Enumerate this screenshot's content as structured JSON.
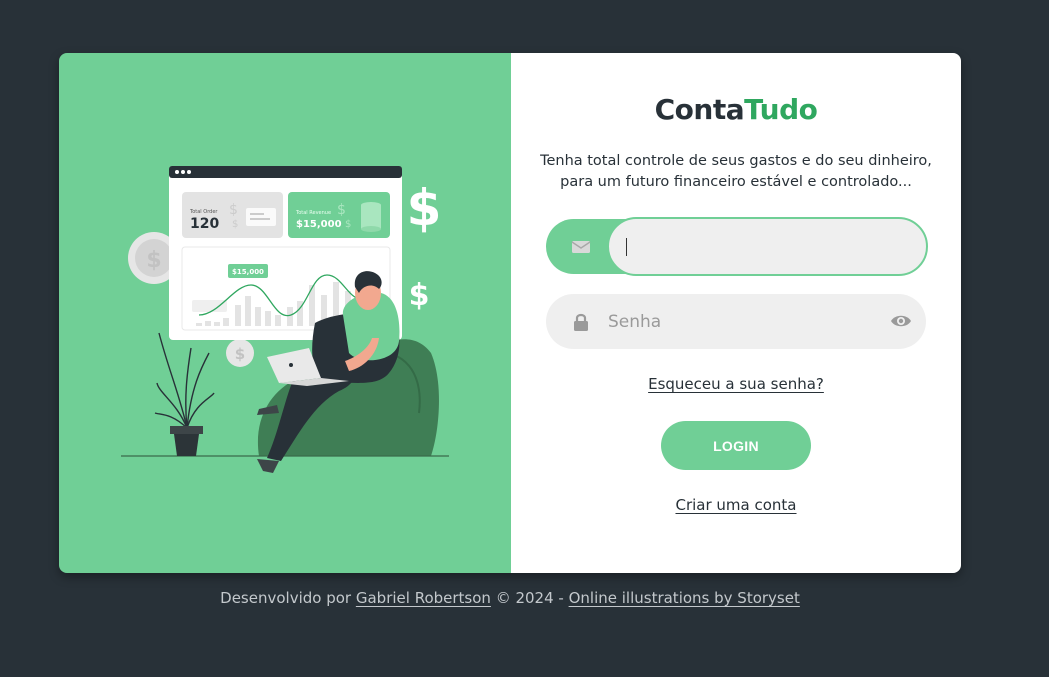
{
  "brand": {
    "part1": "Conta",
    "part2": "Tudo"
  },
  "tagline": "Tenha total controle de seus gastos e do seu dinheiro, para um futuro financeiro estável e controlado...",
  "email_field": {
    "value": "",
    "placeholder": "",
    "icon": "envelope-icon"
  },
  "password_field": {
    "value": "",
    "placeholder": "Senha",
    "icon": "lock-icon",
    "toggle_icon": "eye-icon"
  },
  "forgot_link": "Esqueceu a sua senha?",
  "login_button": "LOGIN",
  "create_link": "Criar uma conta",
  "illustration": {
    "dollar_sign": "$",
    "total_order_label": "Total Order",
    "total_order_value": "120",
    "total_revenue_label": "Total Revenue",
    "total_revenue_value": "$15,000",
    "chart_callout": "$15,000"
  },
  "footer": {
    "prefix": "Desenvolvido por ",
    "author": "Gabriel Robertson",
    "middle": " © 2024 - ",
    "credit": "Online illustrations by Storyset"
  },
  "colors": {
    "background": "#283138",
    "accent": "#70cf96",
    "brand_green": "#2fa75f",
    "text_dark": "#283138"
  }
}
